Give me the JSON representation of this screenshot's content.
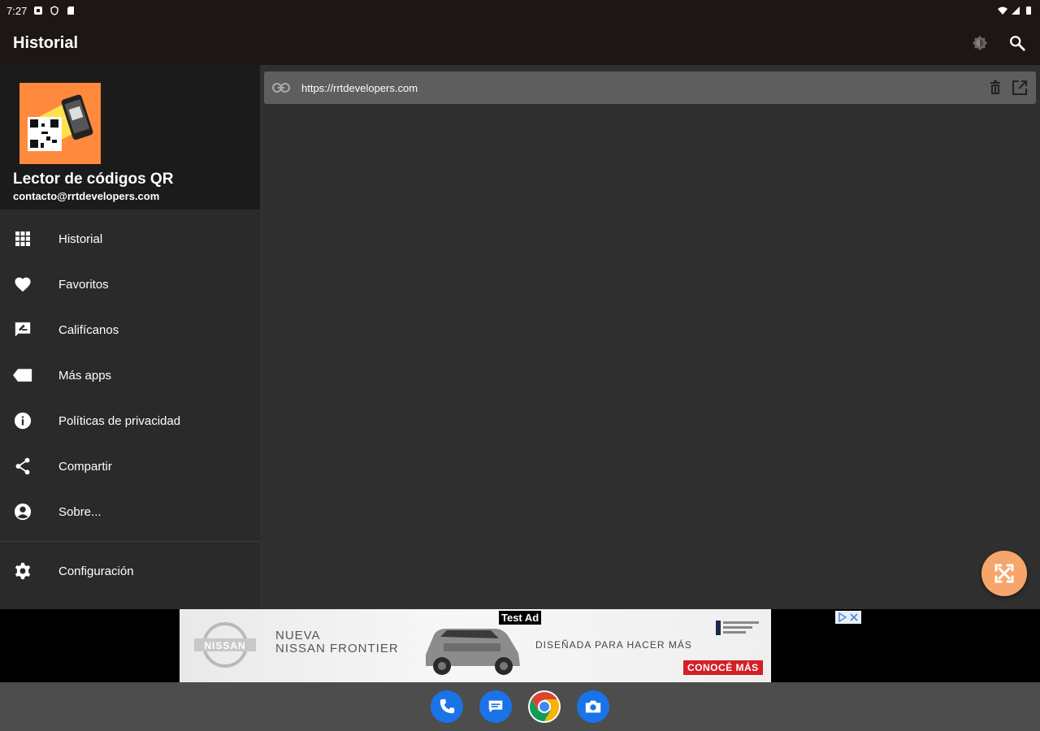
{
  "status_bar": {
    "time": "7:27"
  },
  "app_bar": {
    "title": "Historial",
    "actions": [
      {
        "name": "brightness-icon"
      },
      {
        "name": "search-icon"
      }
    ]
  },
  "drawer": {
    "app_name": "Lector de códigos QR",
    "email": "contacto@rrtdevelopers.com",
    "items": [
      {
        "label": "Historial",
        "icon": "grid-icon"
      },
      {
        "label": "Favoritos",
        "icon": "heart-icon"
      },
      {
        "label": "Califícanos",
        "icon": "rate-review-icon"
      },
      {
        "label": "Más apps",
        "icon": "label-tag-icon"
      },
      {
        "label": "Políticas de privacidad",
        "icon": "info-icon"
      },
      {
        "label": "Compartir",
        "icon": "share-icon"
      },
      {
        "label": "Sobre...",
        "icon": "account-circle-icon"
      }
    ],
    "settings": {
      "label": "Configuración",
      "icon": "settings-icon"
    }
  },
  "history": {
    "items": [
      {
        "url": "https://rrtdevelopers.com"
      }
    ]
  },
  "ad": {
    "badge": "Test Ad",
    "brand": "NISSAN",
    "headline_1": "NUEVA",
    "headline_2": "NISSAN FRONTIER",
    "tagline": "DISEÑADA PARA HACER MÁS",
    "cta": "CONOCÉ MÁS"
  },
  "dock": [
    {
      "name": "phone-icon",
      "color": "#1a73e8"
    },
    {
      "name": "messages-icon",
      "color": "#1a73e8"
    },
    {
      "name": "chrome-icon",
      "color": "#ffffff"
    },
    {
      "name": "camera-icon",
      "color": "#1a73e8"
    }
  ],
  "colors": {
    "app_bar": "#1e1614",
    "drawer": "#2a2a2a",
    "main": "#303030",
    "fab": "#f7a66b",
    "logo_bg": "#ff8a3d"
  }
}
